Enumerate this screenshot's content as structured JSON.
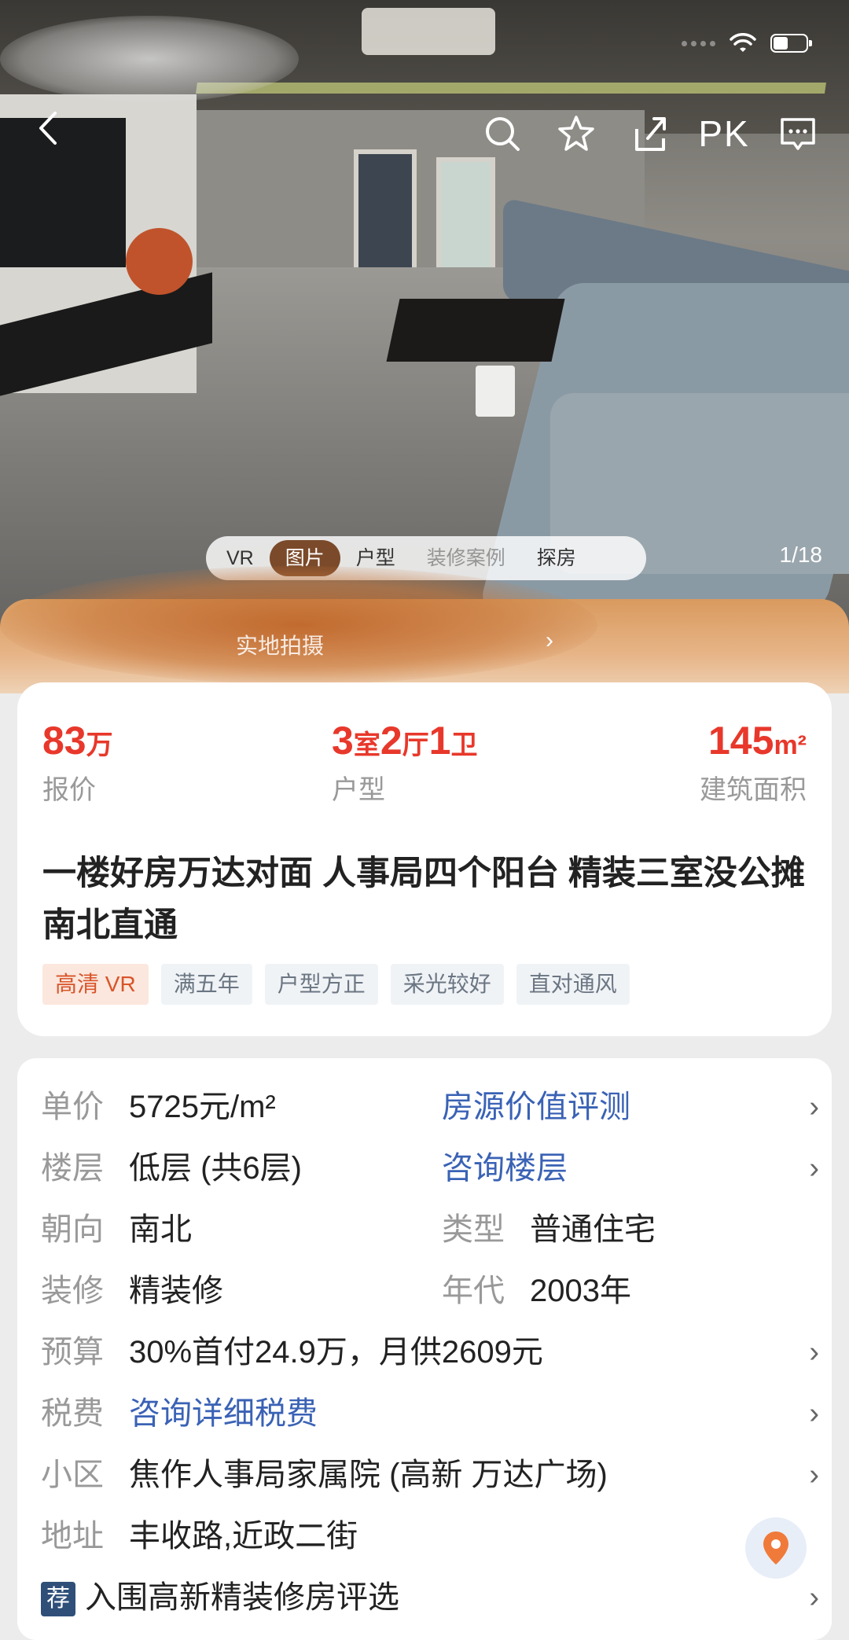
{
  "media": {
    "tabs": [
      "VR",
      "图片",
      "户型",
      "装修案例",
      "探房"
    ],
    "active_tab": "图片",
    "counter": "1/18",
    "banner_text": "实地拍摄"
  },
  "top_actions": {
    "pk_label": "PK"
  },
  "summary": {
    "price": {
      "value": "83",
      "unit": "万",
      "label": "报价"
    },
    "layout": {
      "r": "3",
      "r_unit": "室",
      "h": "2",
      "h_unit": "厅",
      "b": "1",
      "b_unit": "卫",
      "label": "户型"
    },
    "area": {
      "value": "145",
      "unit": "m²",
      "label": "建筑面积"
    },
    "title": "一楼好房万达对面 人事局四个阳台 精装三室没公摊 南北直通",
    "tags": [
      "高清 VR",
      "满五年",
      "户型方正",
      "采光较好",
      "直对通风"
    ]
  },
  "details": {
    "unit_price": {
      "key": "单价",
      "value": "5725元/m²",
      "link": "房源价值评测"
    },
    "floor": {
      "key": "楼层",
      "value": "低层 (共6层)",
      "link": "咨询楼层"
    },
    "orientation": {
      "key": "朝向",
      "value": "南北",
      "key2": "类型",
      "value2": "普通住宅"
    },
    "decoration": {
      "key": "装修",
      "value": "精装修",
      "key2": "年代",
      "value2": "2003年"
    },
    "budget": {
      "key": "预算",
      "value": "30%首付24.9万，月供2609元"
    },
    "tax": {
      "key": "税费",
      "value": "咨询详细税费"
    },
    "community": {
      "key": "小区",
      "value": "焦作人事局家属院 (高新 万达广场)"
    },
    "address": {
      "key": "地址",
      "value": "丰收路,近政二街"
    },
    "recommend": {
      "badge": "荐",
      "value": "入围高新精装修房评选"
    }
  },
  "colors": {
    "price_red": "#e8382b",
    "link_blue": "#3a62b5",
    "active_tab": "#7b4a2a",
    "vr_tag": "#d9542a"
  }
}
